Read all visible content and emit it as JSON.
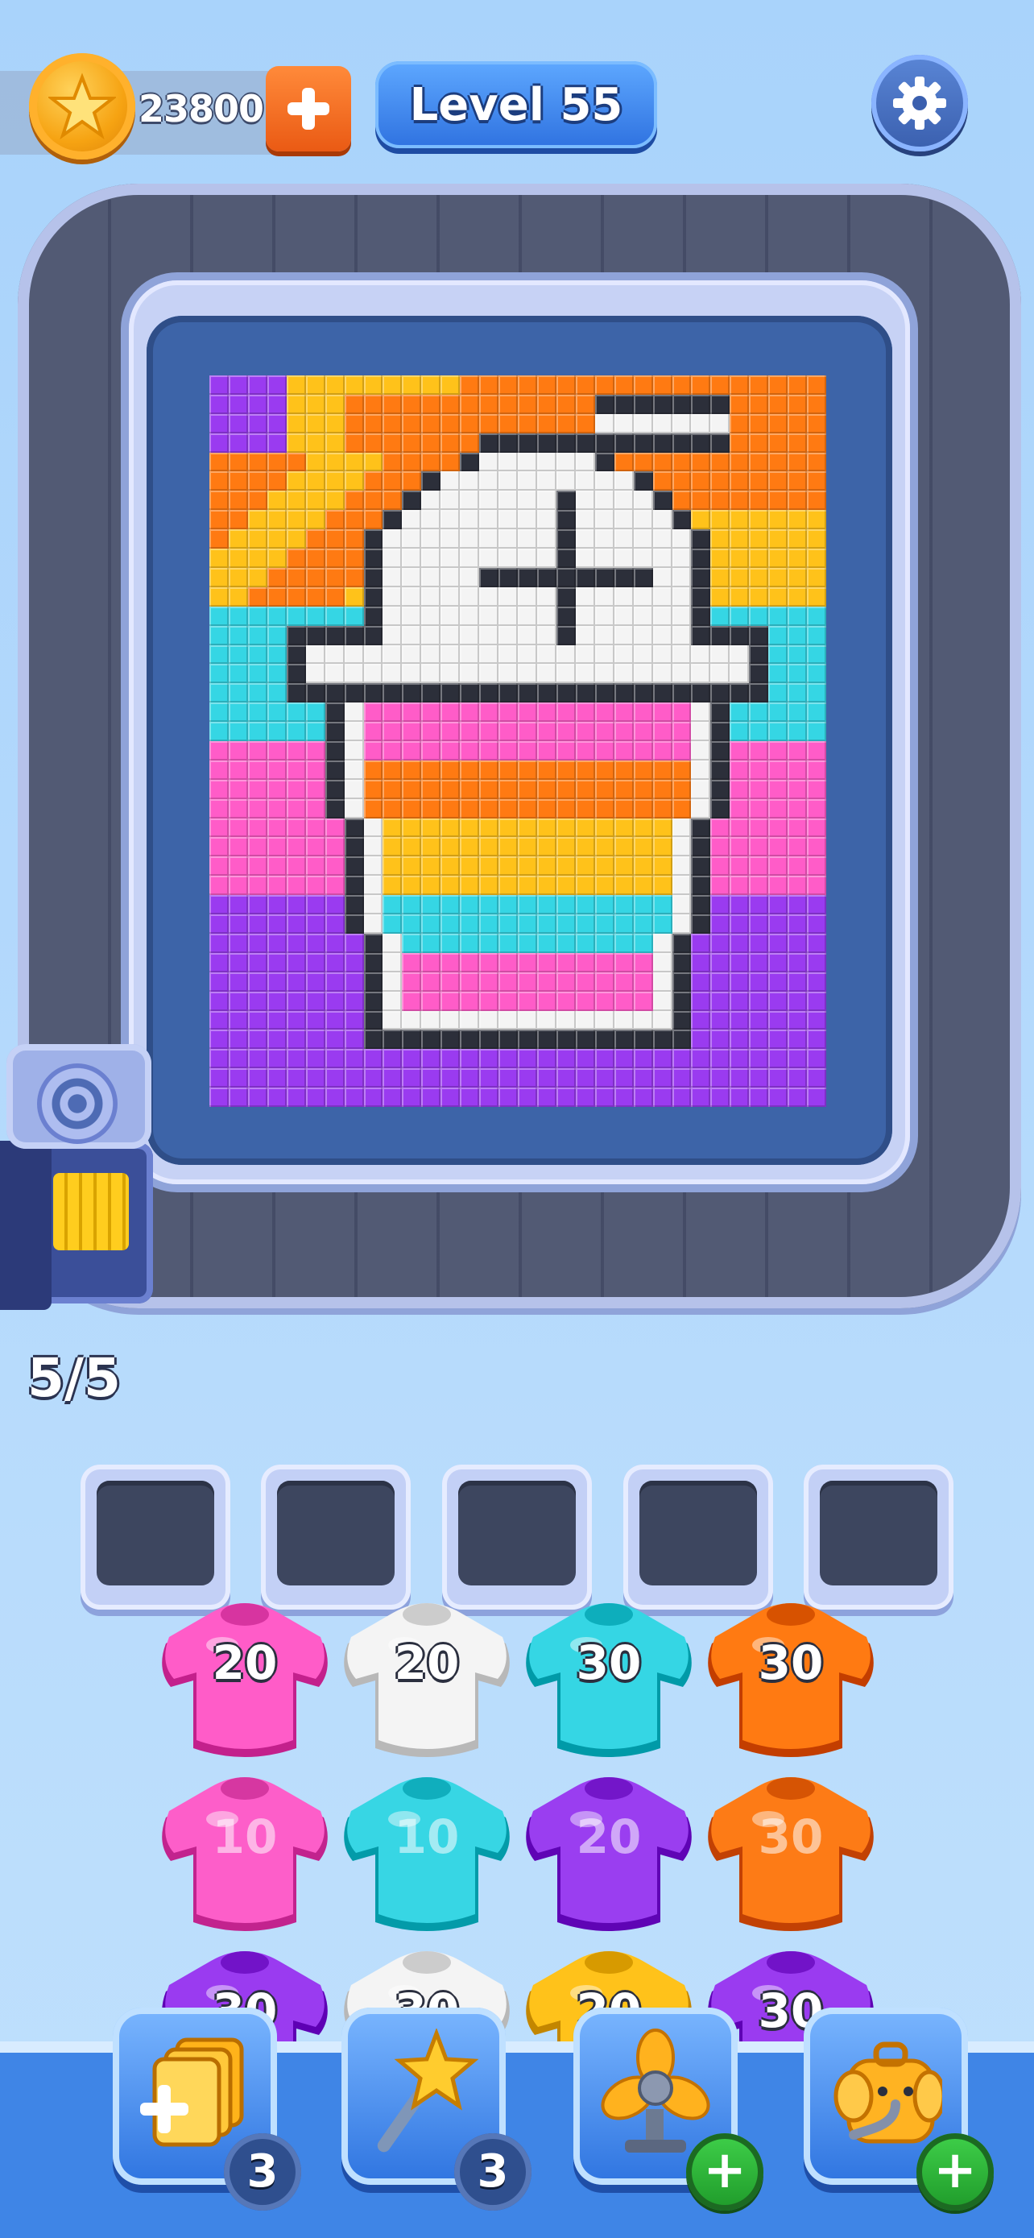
{
  "hud": {
    "coins": "23800",
    "level": "Level 55",
    "capacity": "5/5"
  },
  "colors": {
    "orange": "#ff7a12",
    "yellow": "#ffc21a",
    "white": "#f4f4f4",
    "black": "#2c2f3a",
    "cyan": "#35d6e4",
    "pink": "#ff5cc8",
    "purple": "#9a3bf0"
  },
  "queue_slots": [
    "",
    "",
    "",
    "",
    ""
  ],
  "shirt_rows": [
    [
      {
        "color": "pink",
        "count": "20"
      },
      {
        "color": "white",
        "count": "20"
      },
      {
        "color": "cyan",
        "count": "30"
      },
      {
        "color": "orange",
        "count": "30"
      }
    ],
    [
      {
        "color": "pink",
        "count": "10"
      },
      {
        "color": "cyan",
        "count": "10"
      },
      {
        "color": "purple",
        "count": "20"
      },
      {
        "color": "orange",
        "count": "30"
      }
    ],
    [
      {
        "color": "purple",
        "count": "30"
      },
      {
        "color": "white",
        "count": "30"
      },
      {
        "color": "yellow",
        "count": "20"
      },
      {
        "color": "purple",
        "count": "30"
      }
    ]
  ],
  "boosters": [
    {
      "name": "add-slot",
      "icon": "add-card-icon",
      "badge": "3"
    },
    {
      "name": "magic-wand",
      "icon": "star-wand-icon",
      "badge": "3"
    },
    {
      "name": "fan",
      "icon": "fan-icon",
      "badge": "+"
    },
    {
      "name": "elephant-vacuum",
      "icon": "elephant-icon",
      "badge": "+"
    }
  ]
}
